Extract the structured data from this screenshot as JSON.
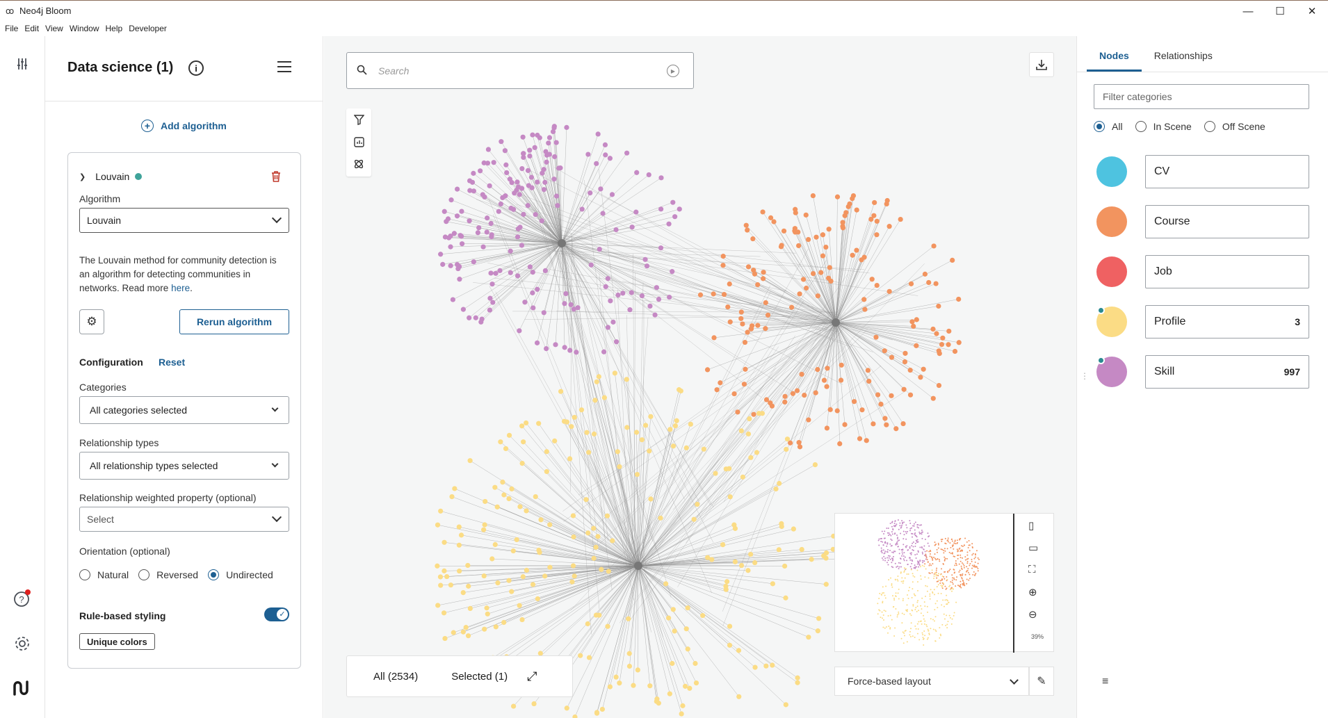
{
  "window": {
    "title": "Neo4j Bloom",
    "controls": [
      "—",
      "☐",
      "✕"
    ]
  },
  "menu": [
    "File",
    "Edit",
    "View",
    "Window",
    "Help",
    "Developer"
  ],
  "panel": {
    "title": "Data science (1)",
    "add_algorithm": "Add algorithm",
    "algo_name": "Louvain",
    "algorithm_label": "Algorithm",
    "algorithm_value": "Louvain",
    "description": "The Louvain method for community detection is an algorithm for detecting communities in networks. Read more ",
    "description_link": "here",
    "rerun": "Rerun algorithm",
    "configuration": "Configuration",
    "reset": "Reset",
    "categories_label": "Categories",
    "categories_value": "All categories selected",
    "reltypes_label": "Relationship types",
    "reltypes_value": "All relationship types selected",
    "weight_label": "Relationship weighted property (optional)",
    "weight_value": "Select",
    "orientation_label": "Orientation (optional)",
    "orientation_options": [
      "Natural",
      "Reversed",
      "Undirected"
    ],
    "orientation_selected": "Undirected",
    "rule_styling": "Rule-based styling",
    "rule_styling_on": true,
    "unique_colors": "Unique colors"
  },
  "canvas": {
    "search_placeholder": "Search",
    "count_all": "All (2534)",
    "count_selected": "Selected (1)",
    "layout": "Force-based layout",
    "minimap_zoom": "39%",
    "clusters": [
      {
        "name": "Skill",
        "color": "#c589c4"
      },
      {
        "name": "Course",
        "color": "#f2945f"
      },
      {
        "name": "Profile",
        "color": "#fbdc85"
      }
    ]
  },
  "right": {
    "tabs": [
      "Nodes",
      "Relationships"
    ],
    "active_tab": "Nodes",
    "filter_placeholder": "Filter categories",
    "scene_options": [
      "All",
      "In Scene",
      "Off Scene"
    ],
    "scene_selected": "All",
    "categories": [
      {
        "name": "CV",
        "color": "#4ec3e0",
        "count": "",
        "marker": false
      },
      {
        "name": "Course",
        "color": "#f2945f",
        "count": "",
        "marker": false
      },
      {
        "name": "Job",
        "color": "#ef6162",
        "count": "",
        "marker": false
      },
      {
        "name": "Profile",
        "color": "#fbdc85",
        "count": "3",
        "marker": true
      },
      {
        "name": "Skill",
        "color": "#c589c4",
        "count": "997",
        "marker": true
      }
    ]
  }
}
